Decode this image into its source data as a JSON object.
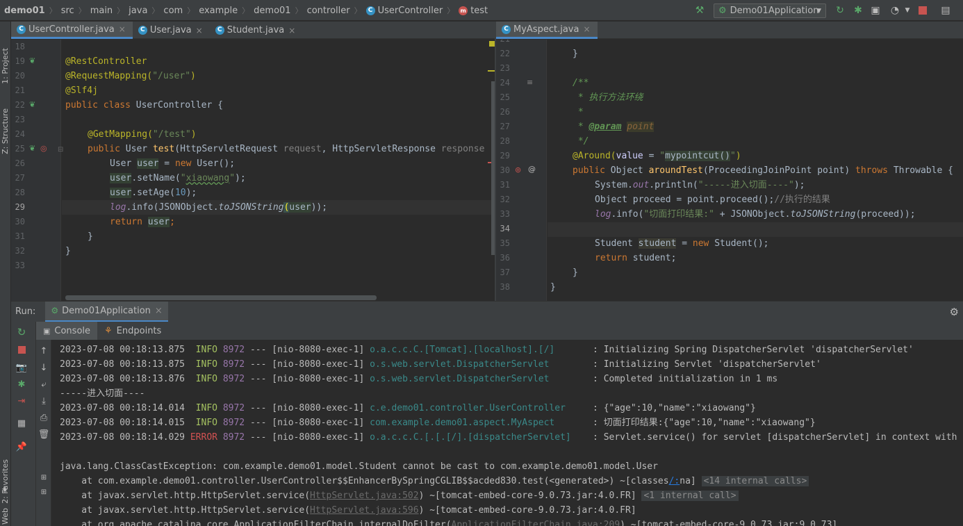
{
  "breadcrumb": [
    "demo01",
    "src",
    "main",
    "java",
    "com",
    "example",
    "demo01",
    "controller",
    "UserController",
    "test"
  ],
  "run_config": "Demo01Application",
  "left_tabs": [
    "1: Project",
    "Z: Structure",
    "2: Favorites",
    "Web"
  ],
  "left_editor": {
    "tabs": [
      {
        "label": "UserController.java",
        "active": true
      },
      {
        "label": "User.java",
        "active": false
      },
      {
        "label": "Student.java",
        "active": false
      }
    ],
    "line_numbers": [
      "18",
      "19",
      "20",
      "21",
      "22",
      "23",
      "24",
      "25",
      "26",
      "27",
      "28",
      "29",
      "30",
      "31",
      "32",
      "33"
    ],
    "lines": {
      "l19": "@RestController",
      "l20a": "@RequestMapping(",
      "l20b": "\"/user\"",
      "l20c": ")",
      "l21": "@Slf4j",
      "l22a": "public class ",
      "l22b": "UserController {",
      "l24a": "@GetMapping(",
      "l24b": "\"/test\"",
      "l24c": ")",
      "l25a": "public ",
      "l25b": "User ",
      "l25c": "test",
      "l25d": "(HttpServletRequest ",
      "l25e": "request",
      ", ": "",
      "l25f": ", HttpServletResponse ",
      "l25g": "response",
      "l26a": "User ",
      "l26b": "user",
      " l26c": "",
      "l26d": " = ",
      "l26e": "new ",
      "l26f": "User();",
      "l27a": "user",
      ".l27b": "",
      "l27c": ".setName(",
      "l27d": "\"",
      "l27e": "xiaowang",
      "l27f": "\"",
      "l27g": ");",
      "l28a": "user",
      "l28c": ".setAge(",
      "l28d": "10",
      "l28e": ");",
      "l29a": "log",
      ".": "",
      "l29b": ".info(JSONObject.",
      "l29c": "toJSONString",
      "l29d": "(",
      "l29e": "user",
      "l29f": "));",
      "l30a": "return ",
      "l30b": "user",
      "l30c": ";",
      "l31": "}",
      "l32": "}"
    }
  },
  "right_editor": {
    "tabs": [
      {
        "label": "MyAspect.java",
        "active": true
      }
    ],
    "line_numbers": [
      "21",
      "22",
      "23",
      "24",
      "25",
      "26",
      "27",
      "28",
      "29",
      "30",
      "31",
      "32",
      "33",
      "34",
      "35",
      "36",
      "37",
      "38"
    ],
    "lines": {
      "r22": "}",
      "r24": "/**",
      "r25": " * 执行方法环绕",
      "r26": " *",
      "r27a": " * ",
      "r27b": "@param",
      "r27c": " ",
      "r27d": "point",
      "r28": " */",
      "r29a": "@Around(",
      "r29b": "value",
      " r29c": "",
      "r29d": " = ",
      "r29e": "\"",
      "r29f": "mypointcut()",
      "r29g": "\"",
      "r29h": ")",
      "r30a": "public ",
      "r30b": "Object ",
      "r30c": "aroundTest",
      "r30d": "(ProceedingJoinPoint point) ",
      "r30e": "throws ",
      "r30f": "Throwable {",
      "r31a": "System.",
      "r31b": "out",
      ".r31c": "",
      "r31d": ".println(",
      "r31e": "\"-----进入切面----\"",
      "r31f": ");",
      "r32a": "Object proceed = point.proceed();",
      "r32b": "//执行的结果",
      "r33a": "log",
      ".r33b": "",
      "r33c": ".info(",
      "r33d": "\"切面打印结果:\"",
      "r33e": " + JSONObject.",
      "r33f": "toJSONString",
      "r33g": "(proceed));",
      "r35a": "Student ",
      "r35b": "student",
      "r35c": " = ",
      "r35d": "new ",
      "r35e": "Student();",
      "r36a": "return ",
      "r36b": "student;",
      "r37": "}",
      "r38": "}"
    }
  },
  "run_panel": {
    "label": "Run:",
    "app_tab": "Demo01Application",
    "subtabs": [
      "Console",
      "Endpoints"
    ],
    "console": [
      {
        "ts": "2023-07-08 00:18:13.875",
        "level": "INFO",
        "pid": "8972",
        "mid": " --- [nio-8080-exec-1] ",
        "logger": "o.a.c.c.C.[Tomcat].[localhost].[/]      ",
        "msg": " : Initializing Spring DispatcherServlet 'dispatcherServlet'"
      },
      {
        "ts": "2023-07-08 00:18:13.875",
        "level": "INFO",
        "pid": "8972",
        "mid": " --- [nio-8080-exec-1] ",
        "logger": "o.s.web.servlet.DispatcherServlet       ",
        "msg": " : Initializing Servlet 'dispatcherServlet'"
      },
      {
        "ts": "2023-07-08 00:18:13.876",
        "level": "INFO",
        "pid": "8972",
        "mid": " --- [nio-8080-exec-1] ",
        "logger": "o.s.web.servlet.DispatcherServlet       ",
        "msg": " : Completed initialization in 1 ms"
      },
      {
        "plain": "-----进入切面----"
      },
      {
        "ts": "2023-07-08 00:18:14.014",
        "level": "INFO",
        "pid": "8972",
        "mid": " --- [nio-8080-exec-1] ",
        "logger": "c.e.demo01.controller.UserController    ",
        "msg": " : {\"age\":10,\"name\":\"xiaowang\"}"
      },
      {
        "ts": "2023-07-08 00:18:14.015",
        "level": "INFO",
        "pid": "8972",
        "mid": " --- [nio-8080-exec-1] ",
        "logger": "com.example.demo01.aspect.MyAspect      ",
        "msg": " : 切面打印结果:{\"age\":10,\"name\":\"xiaowang\"}"
      },
      {
        "ts": "2023-07-08 00:18:14.029",
        "level": "ERROR",
        "pid": "8972",
        "mid": " --- [nio-8080-exec-1] ",
        "logger": "o.a.c.c.C.[.[.[/].[dispatcherServlet]   ",
        "msg": " : Servlet.service() for servlet [dispatcherServlet] in context with"
      },
      {
        "plain": ""
      },
      {
        "plain": "java.lang.ClassCastException: com.example.demo01.model.Student cannot be cast to com.example.demo01.model.User"
      }
    ],
    "stack": [
      {
        "pre": "    at com.example.demo01.controller.UserController$$EnhancerBySpringCGLIB$$acded830.test(<generated>) ~[classes",
        "link": "/:",
        "post": "na]",
        "badge": "<14 internal calls>"
      },
      {
        "pre": "    at javax.servlet.http.HttpServlet.service(",
        "link": "HttpServlet.java:502",
        "post": ") ~[tomcat-embed-core-9.0.73.jar:4.0.FR]",
        "badge": "<1 internal call>"
      },
      {
        "pre": "    at javax.servlet.http.HttpServlet.service(",
        "link": "HttpServlet.java:596",
        "post": ") ~[tomcat-embed-core-9.0.73.jar:4.0.FR]",
        "badge": ""
      },
      {
        "pre": "    at org.apache.catalina.core.ApplicationFilterChain.internalDoFilter(",
        "link": "ApplicationFilterChain.java:209",
        "post": ") ~[tomcat-embed-core-9.0.73.jar:9.0.73]",
        "badge": ""
      }
    ]
  }
}
